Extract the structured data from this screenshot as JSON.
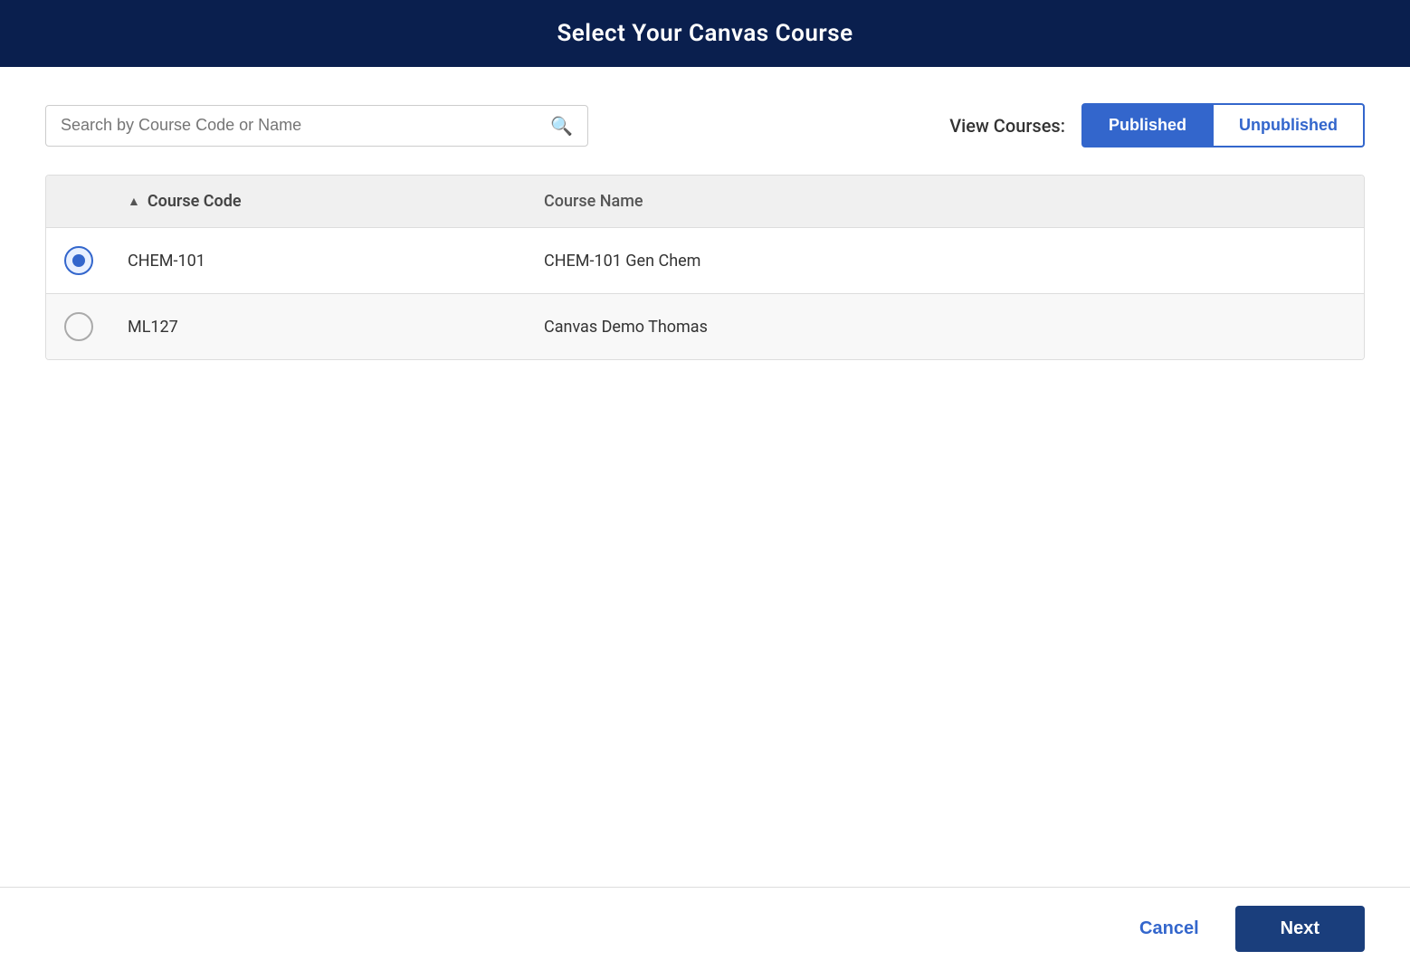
{
  "header": {
    "title": "Select Your Canvas Course"
  },
  "toolbar": {
    "search_placeholder": "Search by Course Code or Name",
    "view_label": "View Courses:",
    "published_label": "Published",
    "unpublished_label": "Unpublished"
  },
  "table": {
    "col_code": "Course Code",
    "col_name": "Course Name",
    "rows": [
      {
        "id": "row-1",
        "code": "CHEM-101",
        "name": "CHEM-101 Gen Chem",
        "selected": true
      },
      {
        "id": "row-2",
        "code": "ML127",
        "name": "Canvas Demo Thomas",
        "selected": false
      }
    ]
  },
  "footer": {
    "cancel_label": "Cancel",
    "next_label": "Next"
  },
  "colors": {
    "primary": "#3366cc",
    "header_bg": "#0a1f4e",
    "btn_dark": "#1a3e7c"
  }
}
